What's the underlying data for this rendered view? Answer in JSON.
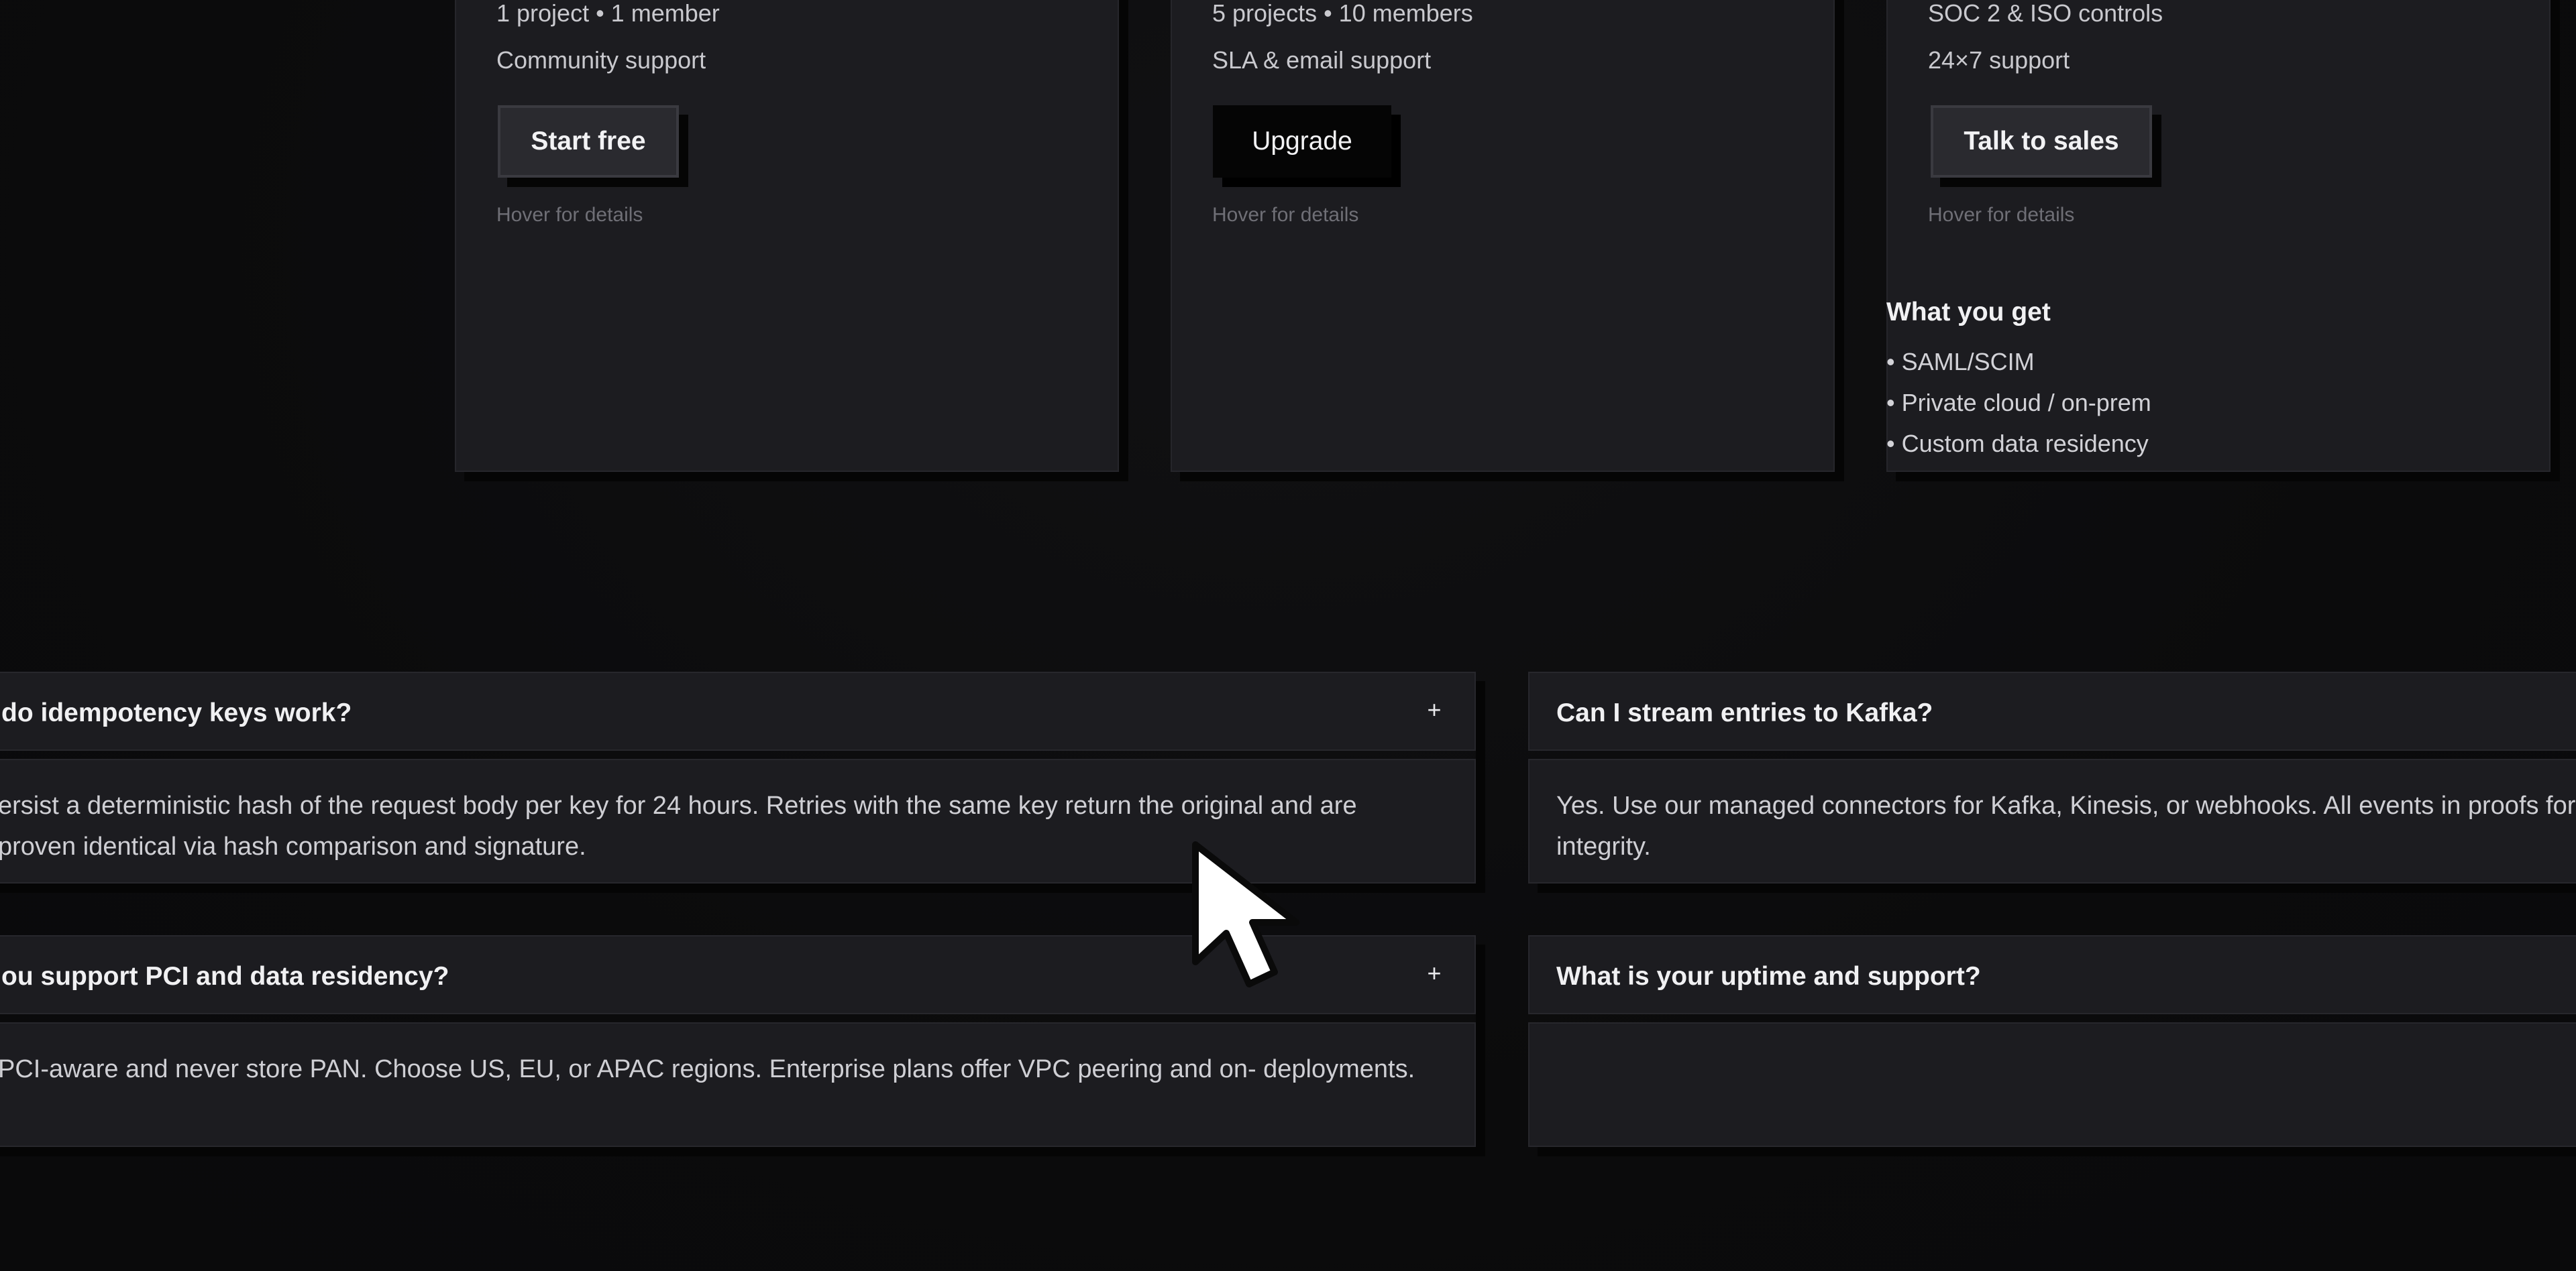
{
  "pricing": {
    "plans": [
      {
        "features": [
          "1 project • 1 member",
          "Community support"
        ],
        "cta": "Start free",
        "hint": "Hover for details"
      },
      {
        "features": [
          "5 projects • 10 members",
          "SLA & email support"
        ],
        "cta": "Upgrade",
        "hint": "Hover for details"
      },
      {
        "features": [
          "SOC 2 & ISO controls",
          "24×7 support"
        ],
        "cta": "Talk to sales",
        "hint": "Hover for details",
        "details": {
          "heading": "What you get",
          "items": [
            "• SAML/SCIM",
            "• Private cloud / on-prem",
            "• Custom data residency"
          ]
        }
      }
    ]
  },
  "faq": {
    "items": [
      {
        "question": "do idempotency keys work?",
        "answer": "ersist a deterministic hash of the request body per key for 24 hours. Retries with the same key return the original  and are proven identical via hash comparison and signature.",
        "toggle": "+"
      },
      {
        "question": "Can I stream entries to Kafka?",
        "answer": "Yes. Use our managed connectors for Kafka, Kinesis, or webhooks. All events in proofs for integrity."
      },
      {
        "question": "ou support PCI and data residency?",
        "answer": " PCI-aware and never store PAN. Choose US, EU, or APAC regions. Enterprise plans offer VPC peering and on- deployments.",
        "toggle": "+"
      },
      {
        "question": "What is your uptime and support?",
        "answer": ""
      }
    ]
  },
  "colors": {
    "background": "#0b0b0c",
    "card": "#1c1c20",
    "primary_button": "#050505",
    "secondary_button": "#2a2a2f"
  },
  "icons": {
    "expand": "plus-icon",
    "cursor": "mouse-pointer-icon"
  }
}
